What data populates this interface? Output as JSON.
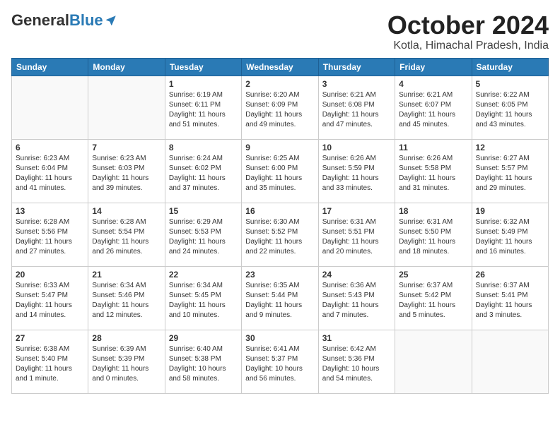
{
  "header": {
    "logo_general": "General",
    "logo_blue": "Blue",
    "title": "October 2024",
    "subtitle": "Kotla, Himachal Pradesh, India"
  },
  "weekdays": [
    "Sunday",
    "Monday",
    "Tuesday",
    "Wednesday",
    "Thursday",
    "Friday",
    "Saturday"
  ],
  "weeks": [
    [
      {
        "day": "",
        "sunrise": "",
        "sunset": "",
        "daylight": ""
      },
      {
        "day": "",
        "sunrise": "",
        "sunset": "",
        "daylight": ""
      },
      {
        "day": "1",
        "sunrise": "Sunrise: 6:19 AM",
        "sunset": "Sunset: 6:11 PM",
        "daylight": "Daylight: 11 hours and 51 minutes."
      },
      {
        "day": "2",
        "sunrise": "Sunrise: 6:20 AM",
        "sunset": "Sunset: 6:09 PM",
        "daylight": "Daylight: 11 hours and 49 minutes."
      },
      {
        "day": "3",
        "sunrise": "Sunrise: 6:21 AM",
        "sunset": "Sunset: 6:08 PM",
        "daylight": "Daylight: 11 hours and 47 minutes."
      },
      {
        "day": "4",
        "sunrise": "Sunrise: 6:21 AM",
        "sunset": "Sunset: 6:07 PM",
        "daylight": "Daylight: 11 hours and 45 minutes."
      },
      {
        "day": "5",
        "sunrise": "Sunrise: 6:22 AM",
        "sunset": "Sunset: 6:05 PM",
        "daylight": "Daylight: 11 hours and 43 minutes."
      }
    ],
    [
      {
        "day": "6",
        "sunrise": "Sunrise: 6:23 AM",
        "sunset": "Sunset: 6:04 PM",
        "daylight": "Daylight: 11 hours and 41 minutes."
      },
      {
        "day": "7",
        "sunrise": "Sunrise: 6:23 AM",
        "sunset": "Sunset: 6:03 PM",
        "daylight": "Daylight: 11 hours and 39 minutes."
      },
      {
        "day": "8",
        "sunrise": "Sunrise: 6:24 AM",
        "sunset": "Sunset: 6:02 PM",
        "daylight": "Daylight: 11 hours and 37 minutes."
      },
      {
        "day": "9",
        "sunrise": "Sunrise: 6:25 AM",
        "sunset": "Sunset: 6:00 PM",
        "daylight": "Daylight: 11 hours and 35 minutes."
      },
      {
        "day": "10",
        "sunrise": "Sunrise: 6:26 AM",
        "sunset": "Sunset: 5:59 PM",
        "daylight": "Daylight: 11 hours and 33 minutes."
      },
      {
        "day": "11",
        "sunrise": "Sunrise: 6:26 AM",
        "sunset": "Sunset: 5:58 PM",
        "daylight": "Daylight: 11 hours and 31 minutes."
      },
      {
        "day": "12",
        "sunrise": "Sunrise: 6:27 AM",
        "sunset": "Sunset: 5:57 PM",
        "daylight": "Daylight: 11 hours and 29 minutes."
      }
    ],
    [
      {
        "day": "13",
        "sunrise": "Sunrise: 6:28 AM",
        "sunset": "Sunset: 5:56 PM",
        "daylight": "Daylight: 11 hours and 27 minutes."
      },
      {
        "day": "14",
        "sunrise": "Sunrise: 6:28 AM",
        "sunset": "Sunset: 5:54 PM",
        "daylight": "Daylight: 11 hours and 26 minutes."
      },
      {
        "day": "15",
        "sunrise": "Sunrise: 6:29 AM",
        "sunset": "Sunset: 5:53 PM",
        "daylight": "Daylight: 11 hours and 24 minutes."
      },
      {
        "day": "16",
        "sunrise": "Sunrise: 6:30 AM",
        "sunset": "Sunset: 5:52 PM",
        "daylight": "Daylight: 11 hours and 22 minutes."
      },
      {
        "day": "17",
        "sunrise": "Sunrise: 6:31 AM",
        "sunset": "Sunset: 5:51 PM",
        "daylight": "Daylight: 11 hours and 20 minutes."
      },
      {
        "day": "18",
        "sunrise": "Sunrise: 6:31 AM",
        "sunset": "Sunset: 5:50 PM",
        "daylight": "Daylight: 11 hours and 18 minutes."
      },
      {
        "day": "19",
        "sunrise": "Sunrise: 6:32 AM",
        "sunset": "Sunset: 5:49 PM",
        "daylight": "Daylight: 11 hours and 16 minutes."
      }
    ],
    [
      {
        "day": "20",
        "sunrise": "Sunrise: 6:33 AM",
        "sunset": "Sunset: 5:47 PM",
        "daylight": "Daylight: 11 hours and 14 minutes."
      },
      {
        "day": "21",
        "sunrise": "Sunrise: 6:34 AM",
        "sunset": "Sunset: 5:46 PM",
        "daylight": "Daylight: 11 hours and 12 minutes."
      },
      {
        "day": "22",
        "sunrise": "Sunrise: 6:34 AM",
        "sunset": "Sunset: 5:45 PM",
        "daylight": "Daylight: 11 hours and 10 minutes."
      },
      {
        "day": "23",
        "sunrise": "Sunrise: 6:35 AM",
        "sunset": "Sunset: 5:44 PM",
        "daylight": "Daylight: 11 hours and 9 minutes."
      },
      {
        "day": "24",
        "sunrise": "Sunrise: 6:36 AM",
        "sunset": "Sunset: 5:43 PM",
        "daylight": "Daylight: 11 hours and 7 minutes."
      },
      {
        "day": "25",
        "sunrise": "Sunrise: 6:37 AM",
        "sunset": "Sunset: 5:42 PM",
        "daylight": "Daylight: 11 hours and 5 minutes."
      },
      {
        "day": "26",
        "sunrise": "Sunrise: 6:37 AM",
        "sunset": "Sunset: 5:41 PM",
        "daylight": "Daylight: 11 hours and 3 minutes."
      }
    ],
    [
      {
        "day": "27",
        "sunrise": "Sunrise: 6:38 AM",
        "sunset": "Sunset: 5:40 PM",
        "daylight": "Daylight: 11 hours and 1 minute."
      },
      {
        "day": "28",
        "sunrise": "Sunrise: 6:39 AM",
        "sunset": "Sunset: 5:39 PM",
        "daylight": "Daylight: 11 hours and 0 minutes."
      },
      {
        "day": "29",
        "sunrise": "Sunrise: 6:40 AM",
        "sunset": "Sunset: 5:38 PM",
        "daylight": "Daylight: 10 hours and 58 minutes."
      },
      {
        "day": "30",
        "sunrise": "Sunrise: 6:41 AM",
        "sunset": "Sunset: 5:37 PM",
        "daylight": "Daylight: 10 hours and 56 minutes."
      },
      {
        "day": "31",
        "sunrise": "Sunrise: 6:42 AM",
        "sunset": "Sunset: 5:36 PM",
        "daylight": "Daylight: 10 hours and 54 minutes."
      },
      {
        "day": "",
        "sunrise": "",
        "sunset": "",
        "daylight": ""
      },
      {
        "day": "",
        "sunrise": "",
        "sunset": "",
        "daylight": ""
      }
    ]
  ]
}
